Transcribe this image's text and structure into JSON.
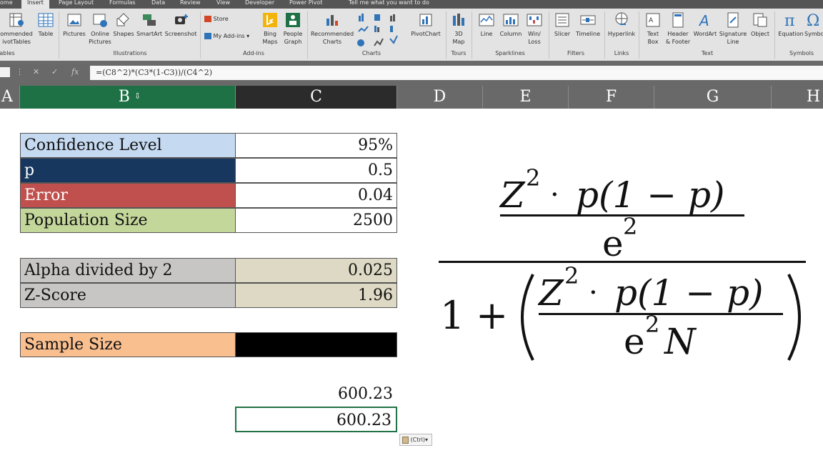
{
  "ribbon": {
    "tabs": [
      "ome",
      "Insert",
      "Page Layout",
      "Formulas",
      "Data",
      "Review",
      "View",
      "Developer",
      "Power Pivot",
      "Tell me what you want to do"
    ],
    "buttons": {
      "recommended_pivottables": [
        "ommended",
        "ivotTables"
      ],
      "table": "Table",
      "pictures": "Pictures",
      "online_pictures": [
        "Online",
        "Pictures"
      ],
      "shapes": "Shapes",
      "smartart": "SmartArt",
      "screenshot": "Screenshot",
      "store": "Store",
      "my_addins": "My Add-ins",
      "bing_maps": [
        "Bing",
        "Maps"
      ],
      "people_graph": [
        "People",
        "Graph"
      ],
      "recommended_charts": [
        "Recommended",
        "Charts"
      ],
      "pivotchart": "PivotChart",
      "map3d": [
        "3D",
        "Map"
      ],
      "line": "Line",
      "column": "Column",
      "winloss": [
        "Win/",
        "Loss"
      ],
      "slicer": "Slicer",
      "timeline": "Timeline",
      "hyperlink": "Hyperlink",
      "text_box": [
        "Text",
        "Box"
      ],
      "header_footer": [
        "Header",
        "& Footer"
      ],
      "wordart": "WordArt",
      "signature_line": [
        "Signature",
        "Line"
      ],
      "object": "Object",
      "equation": "Equation",
      "symbol": "Symbo"
    },
    "groups": [
      "ables",
      "Illustrations",
      "Add-ins",
      "Charts",
      "Tours",
      "Sparklines",
      "Filters",
      "Links",
      "Text",
      "Symbols"
    ]
  },
  "formula_bar": {
    "formula": "=(C8^2)*(C3*(1-C3))/(C4^2)",
    "fx_label": "fx"
  },
  "columns": [
    "A",
    "B",
    "C",
    "D",
    "E",
    "F",
    "G",
    "H"
  ],
  "colors": {
    "confidence": "#c5d9f1",
    "p": "#17375e",
    "error": "#c0504d",
    "population": "#c4d79b",
    "alpha": "#c8c5c5",
    "zscore": "#c8c5c5",
    "value_tan": "#ddd9c4",
    "sample": "#fabf8f",
    "sample_value": "#000000",
    "selected_column": "#1e7145"
  },
  "table1": [
    {
      "label": "Confidence Level",
      "value": "95%"
    },
    {
      "label": "p",
      "value": "0.5"
    },
    {
      "label": "Error",
      "value": "0.04"
    },
    {
      "label": "Population Size",
      "value": "2500"
    }
  ],
  "table2": [
    {
      "label": "Alpha divided by 2",
      "value": "0.025"
    },
    {
      "label": "Z-Score",
      "value": "1.96"
    }
  ],
  "sample": {
    "label": "Sample Size",
    "value": ""
  },
  "results": {
    "plain": "600.23",
    "selected": "600.23"
  },
  "paste_options": "(Ctrl)",
  "formula_image": {
    "numerator": {
      "z": "Z",
      "exp": "2",
      "dot": "·",
      "p_expr": "p(1 − p)",
      "denominator": "e",
      "den_exp": "2"
    },
    "denominator": {
      "one": "1",
      "plus": "+",
      "z": "Z",
      "exp": "2",
      "dot": "·",
      "p_expr": "p(1 − p)",
      "e": "e",
      "e_exp": "2",
      "n": "N"
    }
  }
}
